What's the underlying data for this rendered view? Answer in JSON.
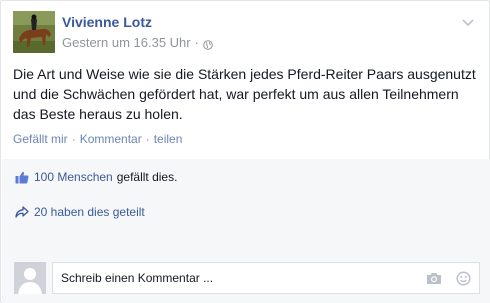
{
  "post": {
    "author": "Vivienne Lotz",
    "timestamp": "Gestern um 16.35 Uhr",
    "meta_separator": "·",
    "privacy_icon": "globe-icon",
    "menu_icon": "chevron-down-icon",
    "text": "Die Art und Weise wie sie die Stärken jedes Pferd-Reiter Paars ausgenutzt und die Schwächen gefördert hat, war perfekt um aus allen Teilnehmern das Beste heraus zu holen."
  },
  "actions": {
    "like": "Gefällt mir",
    "comment": "Kommentar",
    "share": "teilen",
    "separator": "·"
  },
  "ufi": {
    "likes_link": "100 Menschen",
    "likes_suffix": "gefällt dies.",
    "likes_icon": "thumbs-up-icon",
    "shares_text": "20 haben dies geteilt",
    "shares_icon": "share-arrow-icon"
  },
  "comment": {
    "placeholder": "Schreib einen Kommentar ...",
    "camera_icon": "camera-icon",
    "emoji_icon": "smiley-icon"
  },
  "colors": {
    "link_blue": "#3b5998",
    "meta_gray": "#90949c",
    "ufi_bg": "#f6f7f9"
  }
}
